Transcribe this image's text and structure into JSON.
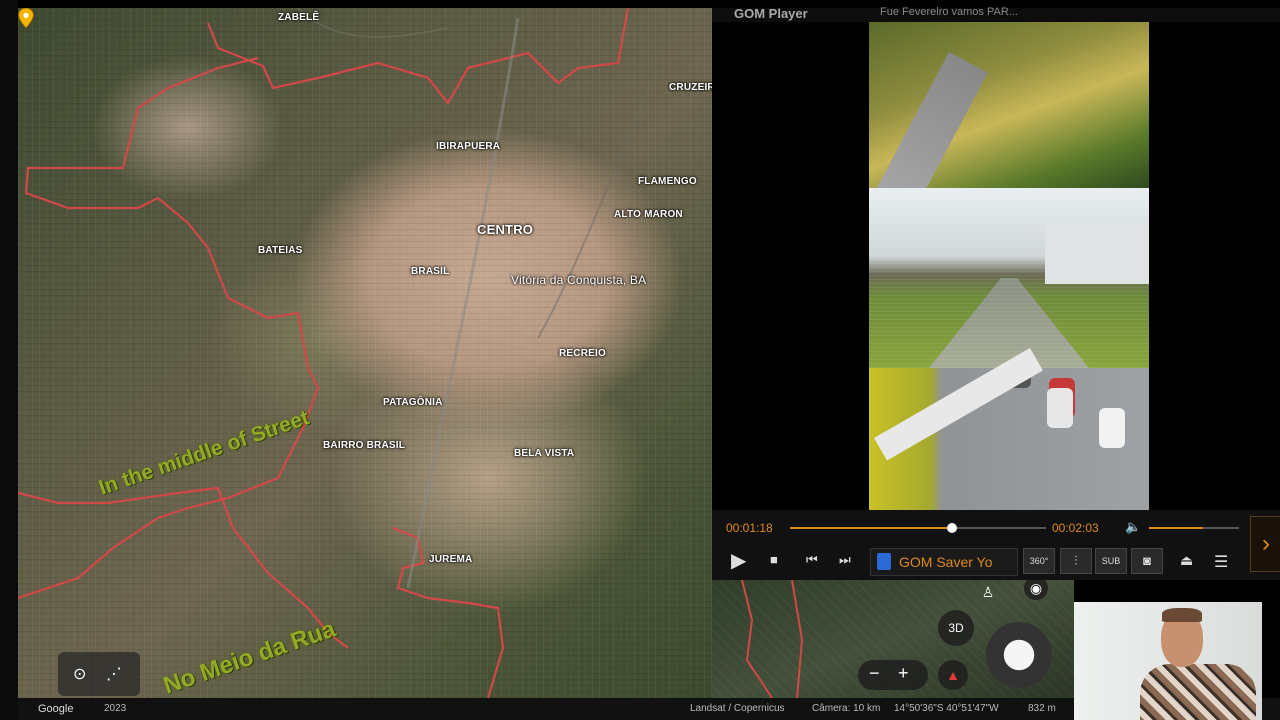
{
  "map": {
    "labels": {
      "zabele": "ZABELÊ",
      "cruzeiro": "CRUZEIR",
      "ibirapuera": "IBIRAPUERA",
      "flamengo": "FLAMENGO",
      "alto_maron": "ALTO MARON",
      "centro": "CENTRO",
      "bateias": "BATEIAS",
      "brasil": "BRASIL",
      "city": "Vitória da Conquista, BA",
      "recreio": "RECREIO",
      "patagonia": "PATAGÔNIA",
      "bairro_brasil": "BAIRRO BRASIL",
      "bela_vista": "BELA VISTA",
      "jurema": "JUREMA"
    },
    "watermark_en": "In the middle of Street",
    "watermark_pt": "No Meio da Rua",
    "controls": {
      "three_d": "3D",
      "zoom_out": "−",
      "zoom_in": "+"
    },
    "bottom": {
      "google": "Google",
      "year": "2023",
      "legal": "Landsat / Copernicus",
      "camera": "Câmera: 10 km",
      "coords": "14°50'36\"S 40°51'47\"W",
      "alt": "832 m"
    },
    "icons": [
      "map-pin-icon",
      "path-icon",
      "pegman-icon",
      "location-icon",
      "compass-icon",
      "globe-icon"
    ]
  },
  "player": {
    "title": "GOM Player",
    "video_title": "Fue Feverelro vamos PAR...",
    "current_time": "00:01:18",
    "total_time": "00:02:03",
    "progress": 0.634,
    "volume": 0.6,
    "gom_saver_label": "GOM Saver Yo",
    "btn_360": "360°",
    "btn_sub": "SUB",
    "accent_color": "#e08a1e"
  }
}
